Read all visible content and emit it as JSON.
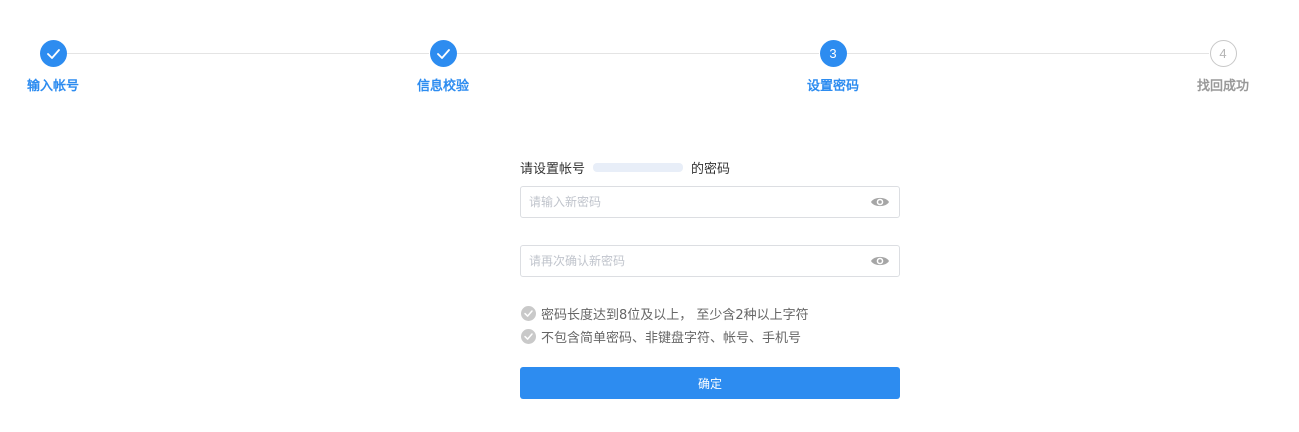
{
  "steps": [
    {
      "number": "1",
      "label": "输入帐号",
      "state": "done"
    },
    {
      "number": "2",
      "label": "信息校验",
      "state": "done"
    },
    {
      "number": "3",
      "label": "设置密码",
      "state": "active"
    },
    {
      "number": "4",
      "label": "找回成功",
      "state": "todo"
    }
  ],
  "form": {
    "title_prefix": "请设置帐号",
    "title_suffix": "的密码",
    "new_password_placeholder": "请输入新密码",
    "confirm_password_placeholder": "请再次确认新密码",
    "rules": [
      "密码长度达到8位及以上， 至少含2种以上字符",
      "不包含简单密码、非键盘字符、帐号、手机号"
    ],
    "submit_label": "确定"
  },
  "colors": {
    "accent": "#2d8cf0",
    "inactive": "#c8c8c8",
    "rule_check": "#c9c9c9"
  },
  "icons": {
    "done_step": "checkmark-icon",
    "password_toggle": "eye-icon",
    "rule_status": "check-circle-icon"
  }
}
